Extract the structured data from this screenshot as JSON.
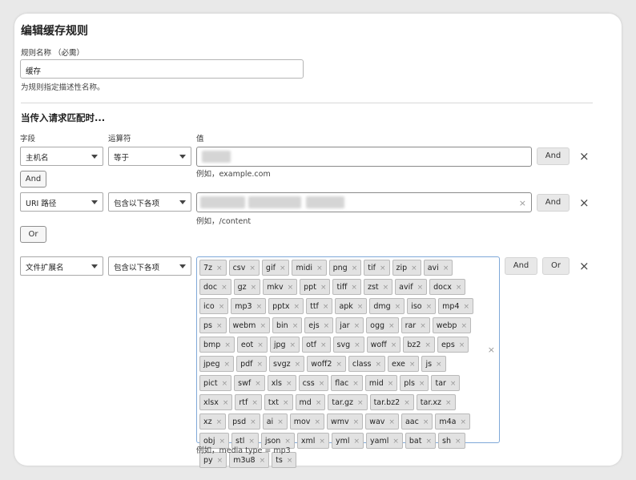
{
  "title": "编辑缓存规则",
  "rule_name": {
    "label": "规则名称 （必需）",
    "value": "缓存",
    "hint": "为规则指定描述性名称。"
  },
  "match_section": "当传入请求匹配时...",
  "columns": {
    "field": "字段",
    "operator": "运算符",
    "value": "值"
  },
  "rows": [
    {
      "field": "主机名",
      "operator": "等于",
      "example": "例如，example.com"
    },
    {
      "field": "URI 路径",
      "operator": "包含以下各项",
      "example": "例如，/content"
    },
    {
      "field": "文件扩展名",
      "operator": "包含以下各项",
      "example": "例如，media type = mp3"
    }
  ],
  "buttons": {
    "and": "And",
    "or": "Or"
  },
  "extensions": [
    "7z",
    "csv",
    "gif",
    "midi",
    "png",
    "tif",
    "zip",
    "avi",
    "doc",
    "gz",
    "mkv",
    "ppt",
    "tiff",
    "zst",
    "avif",
    "docx",
    "ico",
    "mp3",
    "pptx",
    "ttf",
    "apk",
    "dmg",
    "iso",
    "mp4",
    "ps",
    "webm",
    "bin",
    "ejs",
    "jar",
    "ogg",
    "rar",
    "webp",
    "bmp",
    "eot",
    "jpg",
    "otf",
    "svg",
    "woff",
    "bz2",
    "eps",
    "jpeg",
    "pdf",
    "svgz",
    "woff2",
    "class",
    "exe",
    "js",
    "pict",
    "swf",
    "xls",
    "css",
    "flac",
    "mid",
    "pls",
    "tar",
    "xlsx",
    "rtf",
    "txt",
    "md",
    "tar.gz",
    "tar.bz2",
    "tar.xz",
    "xz",
    "psd",
    "ai",
    "mov",
    "wmv",
    "wav",
    "aac",
    "m4a",
    "obj",
    "stl",
    "json",
    "xml",
    "yml",
    "yaml",
    "bat",
    "sh",
    "py",
    "m3u8",
    "ts"
  ],
  "icons": {
    "remove": "close-icon",
    "tag_remove": "×",
    "dropdown": "chevron-down-icon"
  },
  "colors": {
    "focus_border": "#7fa8d8",
    "tag_bg": "#e2e2e2",
    "button_bg": "#e8e8e8"
  }
}
